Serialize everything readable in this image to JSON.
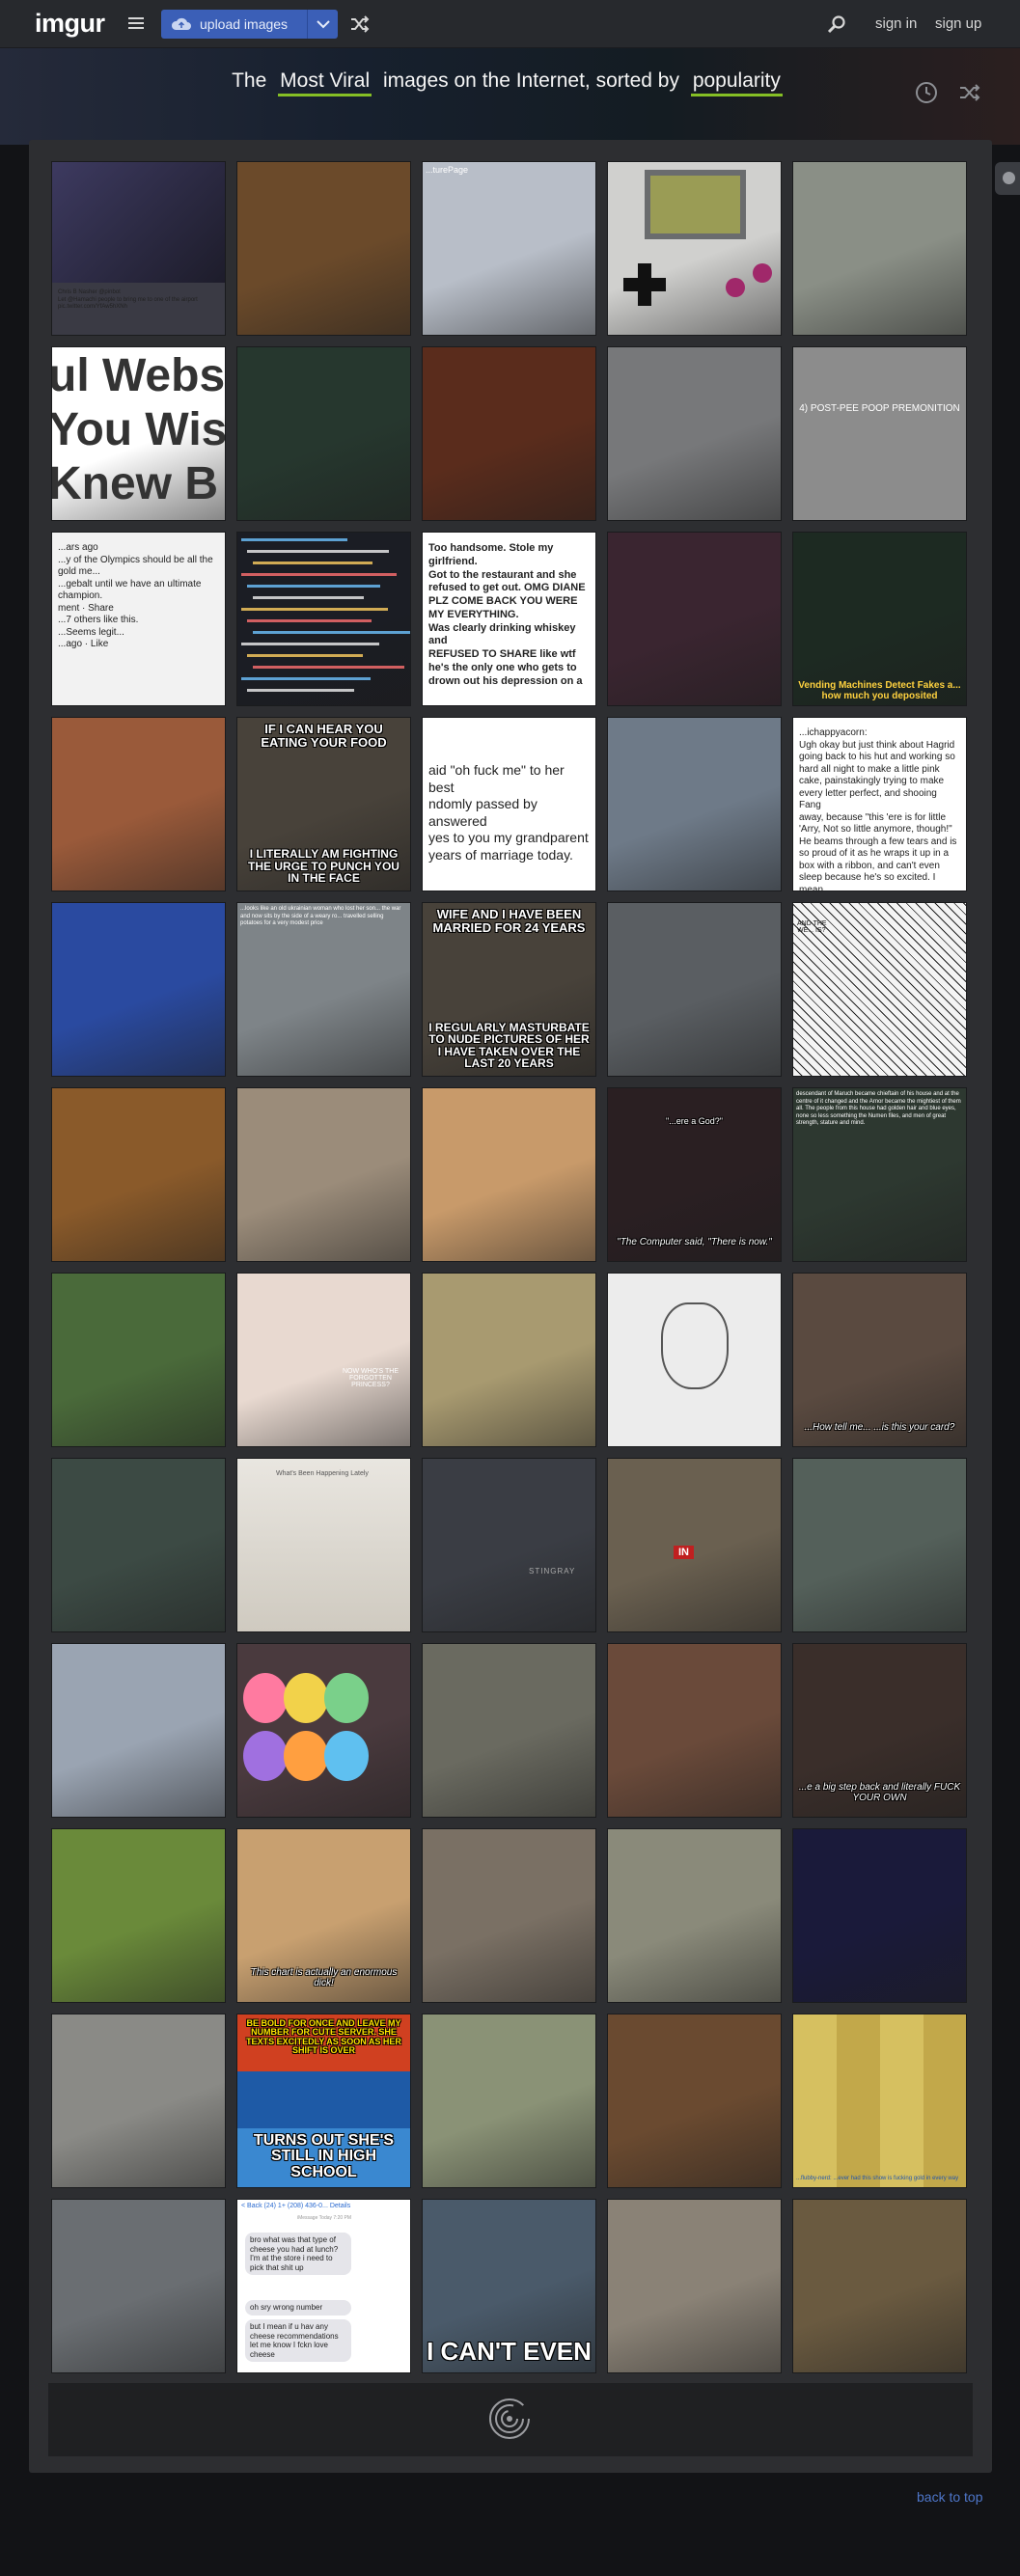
{
  "header": {
    "logo": "imgur",
    "upload_label": "upload images",
    "signin": "sign in",
    "signup": "sign up"
  },
  "hero": {
    "prefix": "The",
    "section": "Most Viral",
    "middle": "images on the Internet, sorted by",
    "sort": "popularity"
  },
  "colors": {
    "accent_green": "#85bf25",
    "upload_blue": "#3b5fb7",
    "link_blue": "#4e76c9"
  },
  "icons": [
    "hamburger-icon",
    "cloud-upload-icon",
    "chevron-down-icon",
    "shuffle-icon",
    "search-icon",
    "clock-icon",
    "chat-icon",
    "spinner-icon"
  ],
  "tiles": [
    {
      "bg": "#3a3a44",
      "kind": "tweet",
      "lines": [
        "Chris B Nasher @pinbot",
        "Let @Hamachi people to bring me to one of the airport",
        "pic.twitter.com/YfAw5hXNh"
      ]
    },
    {
      "bg": "#6b4a2a",
      "kind": "plain"
    },
    {
      "bg": "#b8bec8",
      "kind": "top",
      "label": "...turePage"
    },
    {
      "bg": "#d0d0ce",
      "kind": "gameboy"
    },
    {
      "bg": "#8a8f86",
      "kind": "plain"
    },
    {
      "bg": "#ffffff",
      "kind": "bigtext",
      "lines": [
        "ul Webs",
        "You Wish",
        "Knew B"
      ]
    },
    {
      "bg": "#26372e",
      "kind": "plain"
    },
    {
      "bg": "#5a2c1c",
      "kind": "plain"
    },
    {
      "bg": "#77787a",
      "kind": "plain"
    },
    {
      "bg": "#8c8c8c",
      "kind": "comic",
      "label": "4) POST-PEE POOP PREMONITION"
    },
    {
      "bg": "#f2f2f2",
      "kind": "fb",
      "lines": [
        "...ars ago",
        "...y of the Olympics should be all the gold me...",
        "...gebalt until we have an ultimate champion.",
        "ment · Share",
        "...7 others like this.",
        "...Seems legit...",
        "...ago · Like"
      ]
    },
    {
      "bg": "#1b1d24",
      "kind": "code"
    },
    {
      "bg": "#ffffff",
      "kind": "review",
      "lines": [
        "Too handsome. Stole my girlfriend.",
        "Got to the restaurant and she",
        "refused to get out. OMG DIANE",
        "PLZ COME BACK YOU WERE",
        "MY EVERYTHING.",
        "Was clearly drinking whiskey and",
        "REFUSED TO SHARE like wtf",
        "he's the only one who gets to",
        "drown out his depression on a"
      ]
    },
    {
      "bg": "#3a2530",
      "kind": "plain"
    },
    {
      "bg": "#1d2a22",
      "kind": "vending",
      "label": "Vending Machines Detect Fakes a... how much you deposited"
    },
    {
      "bg": "#9a5a3a",
      "kind": "plain"
    },
    {
      "bg": "#48423a",
      "kind": "meme",
      "top": "IF I CAN HEAR YOU EATING YOUR FOOD",
      "bottom": "I LITERALLY AM FIGHTING THE URGE TO PUNCH YOU IN THE FACE"
    },
    {
      "bg": "#ffffff",
      "kind": "quote",
      "lines": [
        "aid \"oh fuck me\" to her best",
        "ndomly passed by answered",
        "yes to you my grandparent",
        "years of marriage today."
      ]
    },
    {
      "bg": "#6e7a88",
      "kind": "plain"
    },
    {
      "bg": "#ffffff",
      "kind": "tumblr",
      "lines": [
        "...ichappyacorn:",
        "Ugh okay but just think about Hagrid",
        "going back to his hut and working so",
        "hard all night to make a little pink",
        "cake, painstakingly trying to make",
        "every letter perfect, and shooing Fang",
        "away, because \"this 'ere is for little",
        "'Arry, Not so little anymore, though!\"",
        "He beams through a few tears and is",
        "so proud of it as he wraps it up in a",
        "box with a ribbon, and can't even",
        "sleep because he's so excited. I mean",
        "HAGRID you guys"
      ]
    },
    {
      "bg": "#2a4aa0",
      "kind": "plain"
    },
    {
      "bg": "#7e8488",
      "kind": "top2",
      "label": "...looks like an old ukrainian woman who lost her son... the war and now sits by the side of a weary ro... travelled selling potatoes for a very modest price"
    },
    {
      "bg": "#48423a",
      "kind": "meme",
      "top": "WIFE AND I HAVE BEEN MARRIED FOR 24 YEARS",
      "bottom": "I REGULARLY MASTURBATE TO NUDE PICTURES OF HER I HAVE TAKEN OVER THE LAST 20 YEARS"
    },
    {
      "bg": "#5a5e62",
      "kind": "plain"
    },
    {
      "bg": "#f0f0f0",
      "kind": "manga",
      "label": "AND THE WE... IS?"
    },
    {
      "bg": "#8a5a2a",
      "kind": "plain"
    },
    {
      "bg": "#9b8c7a",
      "kind": "plain"
    },
    {
      "bg": "#c89a6a",
      "kind": "plain"
    },
    {
      "bg": "#2a1f22",
      "kind": "sub",
      "top": "\"...ere a God?\"",
      "bottom": "\"The Computer said, \"There is now.\""
    },
    {
      "bg": "#2d3830",
      "kind": "top2",
      "label": "descendant of Maruch became chieftain of his house and at the centre of it changed and the Arnor became the mightiest of them all. The people from this house had golden hair and blue eyes, none so less something the Numen files, and men of great strength, stature and mind."
    },
    {
      "bg": "#4a6a3a",
      "kind": "plain"
    },
    {
      "bg": "#e8d9d0",
      "kind": "comicgirl",
      "label": "NOW WHO'S THE FORGOTTEN PRINCESS?"
    },
    {
      "bg": "#a89a70",
      "kind": "plain"
    },
    {
      "bg": "#e6e6e6",
      "kind": "sketch"
    },
    {
      "bg": "#5a4a40",
      "kind": "sub",
      "top": "",
      "bottom": "...How tell me... ...is this your card?"
    },
    {
      "bg": "#3c4a44",
      "kind": "plain"
    },
    {
      "bg": "#443a32",
      "kind": "paper",
      "label": "What's Been Happening Lately"
    },
    {
      "bg": "#3a3d44",
      "kind": "car",
      "label": "STINGRAY"
    },
    {
      "bg": "#6a6050",
      "kind": "door",
      "label": "IN"
    },
    {
      "bg": "#54605a",
      "kind": "plain"
    },
    {
      "bg": "#9aa4b2",
      "kind": "plain"
    },
    {
      "bg": "#4a3a3e",
      "kind": "balloons"
    },
    {
      "bg": "#6a6a60",
      "kind": "plain"
    },
    {
      "bg": "#6a4a3a",
      "kind": "plain"
    },
    {
      "bg": "#3a2e2a",
      "kind": "sub",
      "top": "",
      "bottom": "...e a big step back and literally FUCK YOUR OWN"
    },
    {
      "bg": "#6a8a3a",
      "kind": "plain"
    },
    {
      "bg": "#c8a070",
      "kind": "sub",
      "top": "",
      "bottom": "This chart is actually an enormous dick!"
    },
    {
      "bg": "#7a7064",
      "kind": "plain"
    },
    {
      "bg": "#8a8a7a",
      "kind": "plain"
    },
    {
      "bg": "#1a1a3a",
      "kind": "plain"
    },
    {
      "bg": "#8a8a86",
      "kind": "plain"
    },
    {
      "bg": "#d04020",
      "kind": "penguin",
      "top": "BE BOLD FOR ONCE AND LEAVE MY NUMBER FOR CUTE SERVER. SHE TEXTS EXCITEDLY AS SOON AS HER SHIFT IS OVER",
      "bottom": "TURNS OUT SHE'S STILL IN HIGH SCHOOL"
    },
    {
      "bg": "#8a9276",
      "kind": "plain"
    },
    {
      "bg": "#6a4a30",
      "kind": "plain"
    },
    {
      "bg": "#e8e8e8",
      "kind": "boxes",
      "label": "...flubby-nerd: ...ever had this show is fucking gold in every way"
    },
    {
      "bg": "#6a6e72",
      "kind": "plain"
    },
    {
      "bg": "#ffffff",
      "kind": "sms",
      "head": "< Back (24)  1+ (208) 436-0...   Details",
      "sub": "iMessage Today 7:20 PM",
      "bubbles": [
        "bro what was that type of cheese you had at lunch? I'm at the store i need to pick that shit up",
        "oh sry wrong number",
        "but I mean if u hav any cheese recommendations let me know I fckn love cheese"
      ]
    },
    {
      "bg": "#4a5a6a",
      "kind": "cant",
      "bottom": "I CAN'T EVEN"
    },
    {
      "bg": "#8a8276",
      "kind": "plain"
    },
    {
      "bg": "#6a5a40",
      "kind": "plain"
    }
  ],
  "footer": {
    "back_to_top": "back to top"
  }
}
